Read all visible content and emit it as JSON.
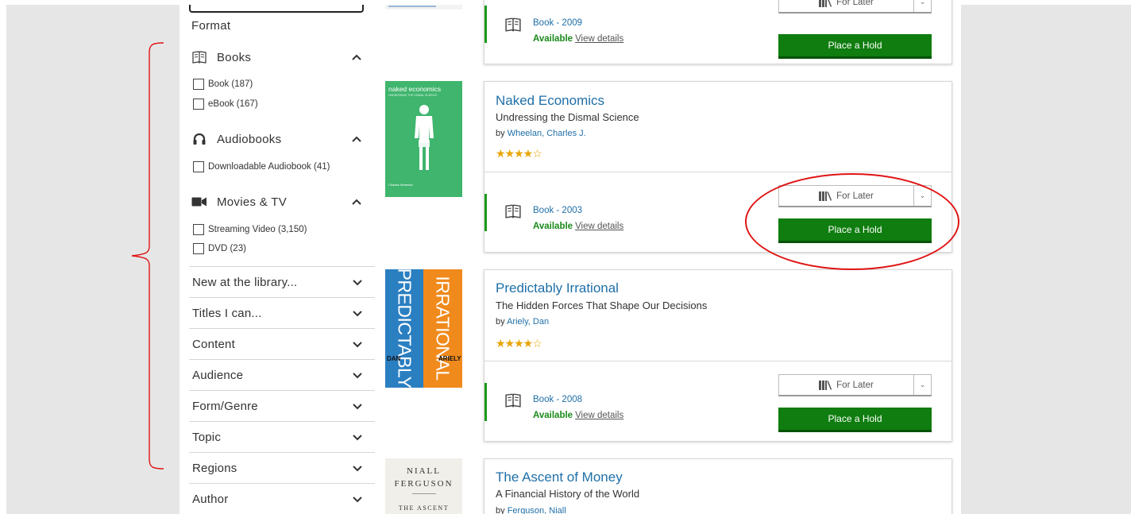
{
  "sidebar": {
    "format_label": "Format",
    "groups": [
      {
        "title": "Books",
        "icon": "book-icon",
        "options": [
          "Book (187)",
          "eBook (167)"
        ]
      },
      {
        "title": "Audiobooks",
        "icon": "headphones-icon",
        "options": [
          "Downloadable Audiobook (41)"
        ]
      },
      {
        "title": "Movies & TV",
        "icon": "video-camera-icon",
        "options": [
          "Streaming Video (3,150)",
          "DVD (23)"
        ]
      }
    ],
    "accordions": [
      "New at the library...",
      "Titles I can...",
      "Content",
      "Audience",
      "Form/Genre",
      "Topic",
      "Regions",
      "Author"
    ]
  },
  "results": [
    {
      "format": "Book - 2009",
      "available": "Available",
      "view_details": "View details",
      "for_later": "For Later",
      "hold": "Place a Hold"
    },
    {
      "title": "Naked Economics",
      "subtitle": "Undressing the Dismal Science",
      "by_prefix": "by",
      "author": "Wheelan, Charles J.",
      "stars": "★★★★☆",
      "rating": 4,
      "format": "Book - 2003",
      "available": "Available",
      "view_details": "View details",
      "for_later": "For Later",
      "hold": "Place a Hold",
      "cover": {
        "top": "naked economics",
        "tag": "UNDRESSING THE DISMAL SCIENCE",
        "author": "Charles Wheelan",
        "color": "#3fb56d"
      }
    },
    {
      "title": "Predictably Irrational",
      "subtitle": "The Hidden Forces That Shape Our Decisions",
      "by_prefix": "by",
      "author": "Ariely, Dan",
      "stars": "★★★★☆",
      "rating": 4,
      "format": "Book - 2008",
      "available": "Available",
      "view_details": "View details",
      "for_later": "For Later",
      "hold": "Place a Hold",
      "cover": {
        "word1": "PREDICTABLY",
        "word2": "IRRATIONAL",
        "author_first": "DAN",
        "author_last": "ARIELY"
      }
    },
    {
      "title": "The Ascent of Money",
      "subtitle": "A Financial History of the World",
      "by_prefix": "by",
      "author": "Ferguson, Niall",
      "cover": {
        "line1": "NIALL",
        "line2": "FERGUSON",
        "line3": "THE ASCENT"
      }
    }
  ],
  "colors": {
    "link": "#1e6fa8",
    "available": "#1a8a1a",
    "hold_button": "#0f7d0f",
    "annotation": "#e01414"
  }
}
